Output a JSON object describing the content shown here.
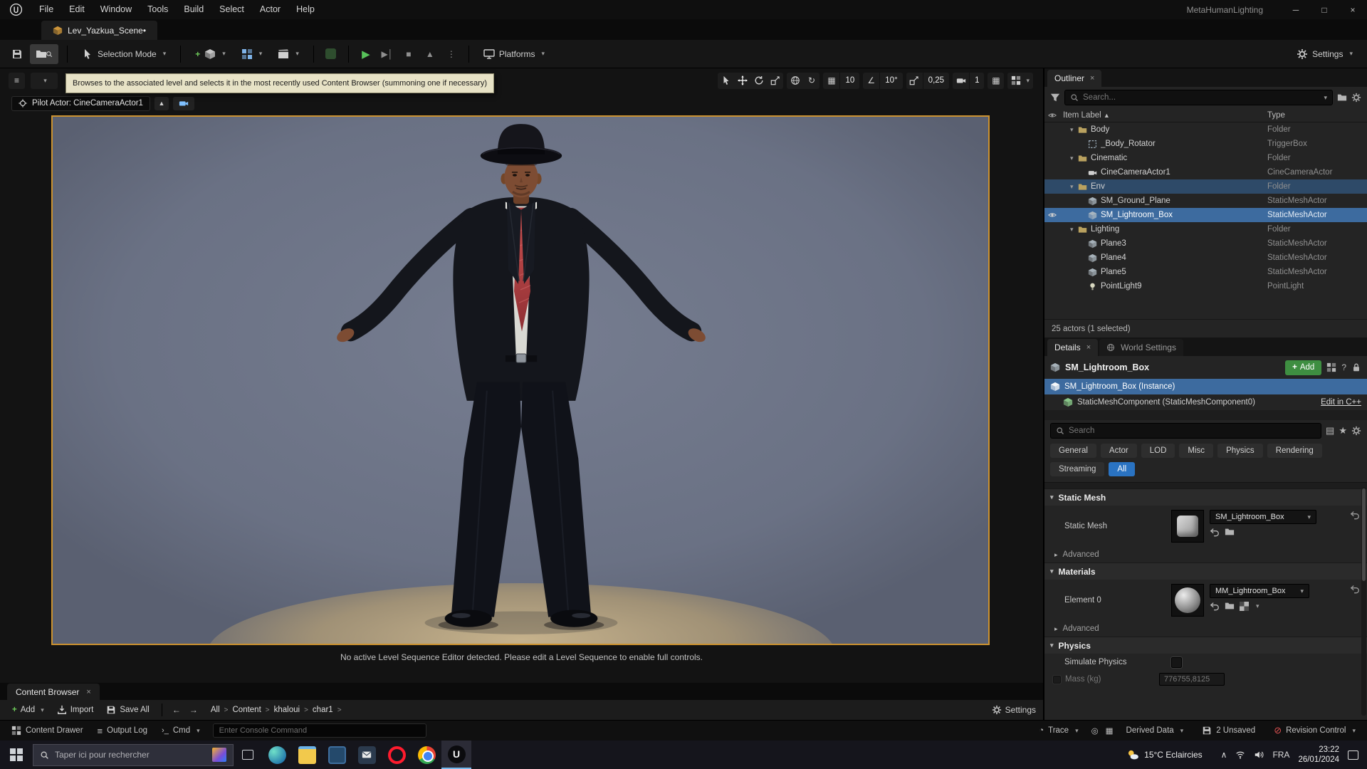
{
  "window": {
    "title": "MetaHumanLighting",
    "menus": [
      "File",
      "Edit",
      "Window",
      "Tools",
      "Build",
      "Select",
      "Actor",
      "Help"
    ]
  },
  "level_tab": {
    "label": "Lev_Yazkua_Scene•"
  },
  "toolbar": {
    "selection_mode": "Selection Mode",
    "platforms": "Platforms",
    "settings": "Settings"
  },
  "tooltip": "Browses to the associated level and selects it in the most recently used Content Browser (summoning one if necessary)",
  "viewport": {
    "pilot_label": "Pilot Actor: CineCameraActor1",
    "snap_grid": "10",
    "snap_angle": "10°",
    "snap_scale": "0,25",
    "camera_speed": "1",
    "message": "No active Level Sequence Editor detected. Please edit a Level Sequence to enable full controls."
  },
  "outliner": {
    "title": "Outliner",
    "search_placeholder": "Search...",
    "col_label": "Item Label",
    "col_type": "Type",
    "rows": [
      {
        "label": "Body",
        "type": "Folder",
        "indent": 1,
        "icon": "folder"
      },
      {
        "label": "_Body_Rotator",
        "type": "TriggerBox",
        "indent": 2,
        "icon": "trigger"
      },
      {
        "label": "Cinematic",
        "type": "Folder",
        "indent": 1,
        "icon": "folder"
      },
      {
        "label": "CineCameraActor1",
        "type": "CineCameraActor",
        "indent": 2,
        "icon": "camera"
      },
      {
        "label": "Env",
        "type": "Folder",
        "indent": 1,
        "icon": "folder",
        "hl": true
      },
      {
        "label": "SM_Ground_Plane",
        "type": "StaticMeshActor",
        "indent": 2,
        "icon": "mesh"
      },
      {
        "label": "SM_Lightroom_Box",
        "type": "StaticMeshActor",
        "indent": 2,
        "icon": "mesh",
        "selected": true,
        "eye": true
      },
      {
        "label": "Lighting",
        "type": "Folder",
        "indent": 1,
        "icon": "folder"
      },
      {
        "label": "Plane3",
        "type": "StaticMeshActor",
        "indent": 2,
        "icon": "mesh"
      },
      {
        "label": "Plane4",
        "type": "StaticMeshActor",
        "indent": 2,
        "icon": "mesh"
      },
      {
        "label": "Plane5",
        "type": "StaticMeshActor",
        "indent": 2,
        "icon": "mesh"
      },
      {
        "label": "PointLight9",
        "type": "PointLight",
        "indent": 2,
        "icon": "light"
      }
    ],
    "footer": "25 actors (1 selected)"
  },
  "details": {
    "tab_details": "Details",
    "tab_world": "World Settings",
    "header_name": "SM_Lightroom_Box",
    "add_label": "Add",
    "instance_label": "SM_Lightroom_Box (Instance)",
    "component_label": "StaticMeshComponent (StaticMeshComponent0)",
    "edit_cpp": "Edit in C++",
    "search_placeholder": "Search",
    "filters": [
      "General",
      "Actor",
      "LOD",
      "Misc",
      "Physics",
      "Rendering",
      "Streaming",
      "All"
    ],
    "active_filter": "All",
    "static_mesh_section": "Static Mesh",
    "static_mesh_label": "Static Mesh",
    "static_mesh_value": "SM_Lightroom_Box",
    "advanced_label": "Advanced",
    "materials_section": "Materials",
    "element0_label": "Element 0",
    "element0_value": "MM_Lightroom_Box",
    "physics_section": "Physics",
    "simulate_label": "Simulate Physics",
    "mass_label": "Mass (kg)",
    "mass_value": "776755,8125"
  },
  "content_browser": {
    "tab": "Content Browser",
    "add": "Add",
    "import": "Import",
    "save_all": "Save All",
    "breadcrumb": [
      "All",
      "Content",
      "khaloui",
      "char1"
    ],
    "settings": "Settings"
  },
  "status_bar": {
    "content_drawer": "Content Drawer",
    "output_log": "Output Log",
    "cmd": "Cmd",
    "console_placeholder": "Enter Console Command",
    "trace": "Trace",
    "derived_data": "Derived Data",
    "unsaved": "2 Unsaved",
    "revision": "Revision Control"
  },
  "taskbar": {
    "search_placeholder": "Taper ici pour rechercher",
    "weather": "15°C Eclaircies",
    "lang": "FRA",
    "time": "23:22",
    "date": "26/01/2024",
    "apps": [
      "edge",
      "explorer",
      "photos",
      "mail",
      "opera",
      "chrome",
      "unreal"
    ]
  }
}
